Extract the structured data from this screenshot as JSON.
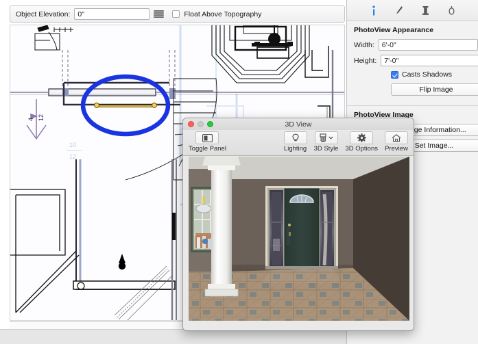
{
  "toolbar": {
    "elevation_label": "Object Elevation:",
    "elevation_value": "0\"",
    "elevation_placeholder": "0\"",
    "list_icon": "hamburger-icon",
    "float_checkbox_label": "Float Above Topography",
    "float_checked": false
  },
  "inspector": {
    "tabs": [
      {
        "name": "info-tab",
        "icon": "info-icon",
        "glyph": "i",
        "active": true
      },
      {
        "name": "pen-tab",
        "icon": "pen-icon",
        "glyph": "pen",
        "active": false
      },
      {
        "name": "column-tab",
        "icon": "column-icon",
        "glyph": "column",
        "active": false
      },
      {
        "name": "light-tab",
        "icon": "light-icon",
        "glyph": "light",
        "active": false
      }
    ],
    "appearance": {
      "title": "PhotoView Appearance",
      "width_label": "Width:",
      "width_value": "6'-0\"",
      "height_label": "Height:",
      "height_value": "7'-0\"",
      "casts_shadows_label": "Casts Shadows",
      "casts_shadows_checked": true,
      "flip_image_label": "Flip Image"
    },
    "image": {
      "title": "PhotoView Image",
      "image_information_label": "Image Information...",
      "set_image_label": "Set Image..."
    }
  },
  "cad": {
    "slope_annotation_rise": "4",
    "slope_annotation_run": "12",
    "dim_annotation_rise": "10",
    "dim_annotation_run": "12",
    "selection_highlight_color": "#1a35e0",
    "selected_wall_color": "#f0b429",
    "handle_color": "#f5c542"
  },
  "window3d": {
    "title": "3D View",
    "traffic_lights": [
      "close-button",
      "minimize-button",
      "zoom-button"
    ],
    "tools": [
      {
        "name": "toggle-panel-button",
        "label": "Toggle Panel",
        "icon": "panel-icon"
      },
      {
        "name": "lighting-button",
        "label": "Lighting",
        "icon": "lightbulb-icon"
      },
      {
        "name": "3d-style-button",
        "label": "3D Style",
        "icon": "paint-roller-icon"
      },
      {
        "name": "3d-options-button",
        "label": "3D Options",
        "icon": "gear-icon"
      },
      {
        "name": "preview-button",
        "label": "Preview",
        "icon": "house-icon"
      }
    ],
    "scene": {
      "description": "entry foyer with front door, sidelights, column and tiled floor",
      "wall_color": "#6c6159",
      "side_wall_color": "#463c36",
      "door_color": "#2e403c",
      "floor_color": "#a08872",
      "column_color": "#f2f2f0",
      "ceiling_color": "#d8d6d2"
    }
  }
}
